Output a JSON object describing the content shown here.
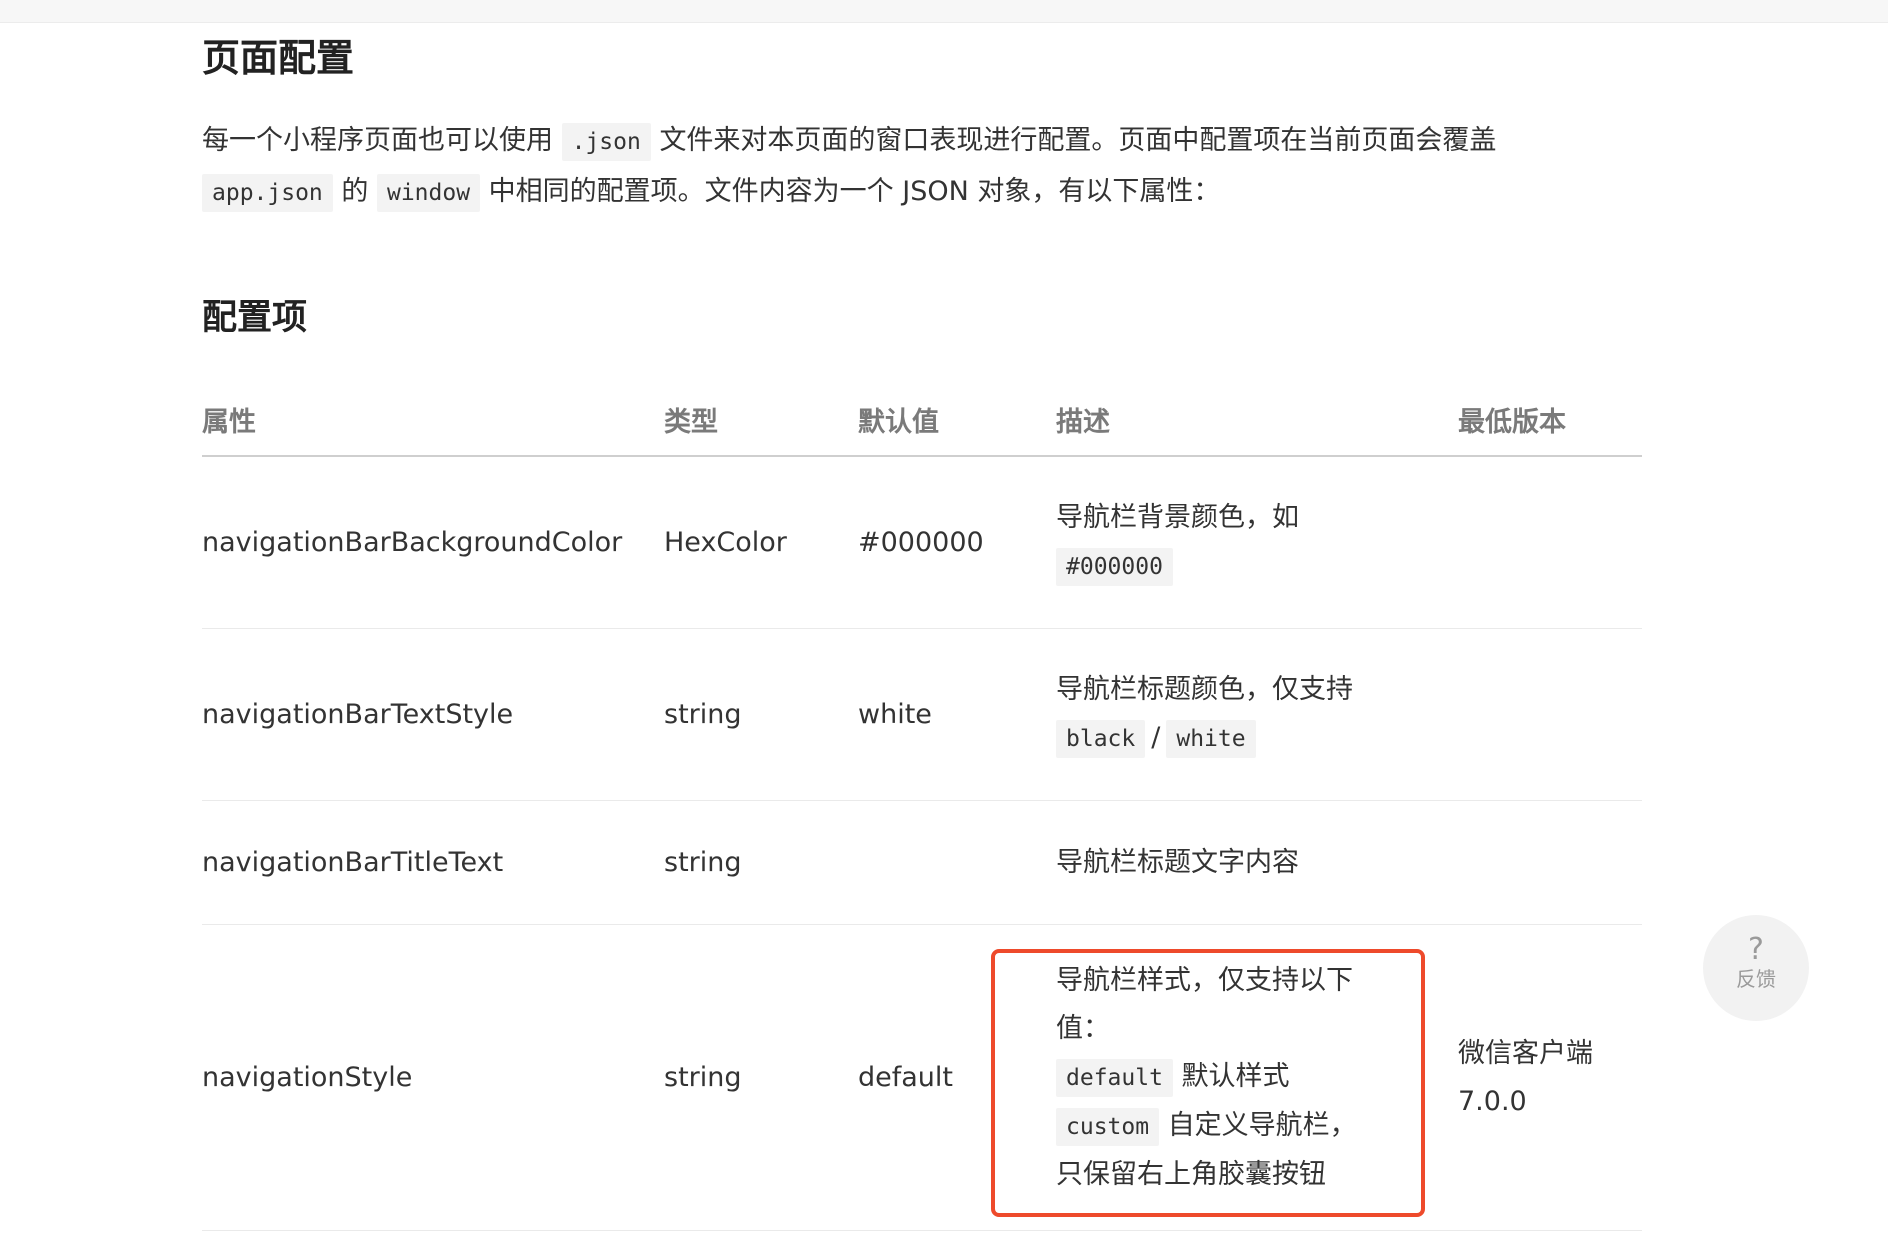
{
  "page": {
    "title": "页面配置",
    "intro": {
      "t1": "每一个小程序页面也可以使用",
      "c1": ".json",
      "t2": "文件来对本页面的窗口表现进行配置。页面中配置项在当前页面会覆盖",
      "c2": "app.json",
      "t3": "的",
      "c3": "window",
      "t4": "中相同的配置项。文件内容为一个 JSON 对象，有以下属性："
    },
    "section_title": "配置项"
  },
  "table": {
    "headers": {
      "property": "属性",
      "type": "类型",
      "default": "默认值",
      "description": "描述",
      "min_version": "最低版本"
    },
    "rows": [
      {
        "property": "navigationBarBackgroundColor",
        "type": "HexColor",
        "default": "#000000",
        "desc_text": "导航栏背景颜色，如",
        "desc_code": "#000000",
        "min_version": ""
      },
      {
        "property": "navigationBarTextStyle",
        "type": "string",
        "default": "white",
        "desc_text": "导航栏标题颜色，仅支持",
        "desc_code1": "black",
        "desc_sep": "/",
        "desc_code2": "white",
        "min_version": ""
      },
      {
        "property": "navigationBarTitleText",
        "type": "string",
        "default": "",
        "desc_text": "导航栏标题文字内容",
        "min_version": ""
      },
      {
        "property": "navigationStyle",
        "type": "string",
        "default": "default",
        "desc_line1": "导航栏样式，仅支持以下",
        "desc_line2": "值：",
        "desc_code1": "default",
        "desc_code1_text": "默认样式",
        "desc_code2": "custom",
        "desc_code2_text": "自定义导航栏，",
        "desc_line5": "只保留右上角胶囊按钮",
        "min_version_line1": "微信客户端",
        "min_version_line2": "7.0.0"
      }
    ]
  },
  "feedback": {
    "icon": "question-mark-icon",
    "glyph": "?",
    "label": "反馈"
  },
  "colors": {
    "highlight": "#ee4a2b",
    "header_text": "#7a7a7a",
    "code_bg": "#f3f3f3"
  }
}
